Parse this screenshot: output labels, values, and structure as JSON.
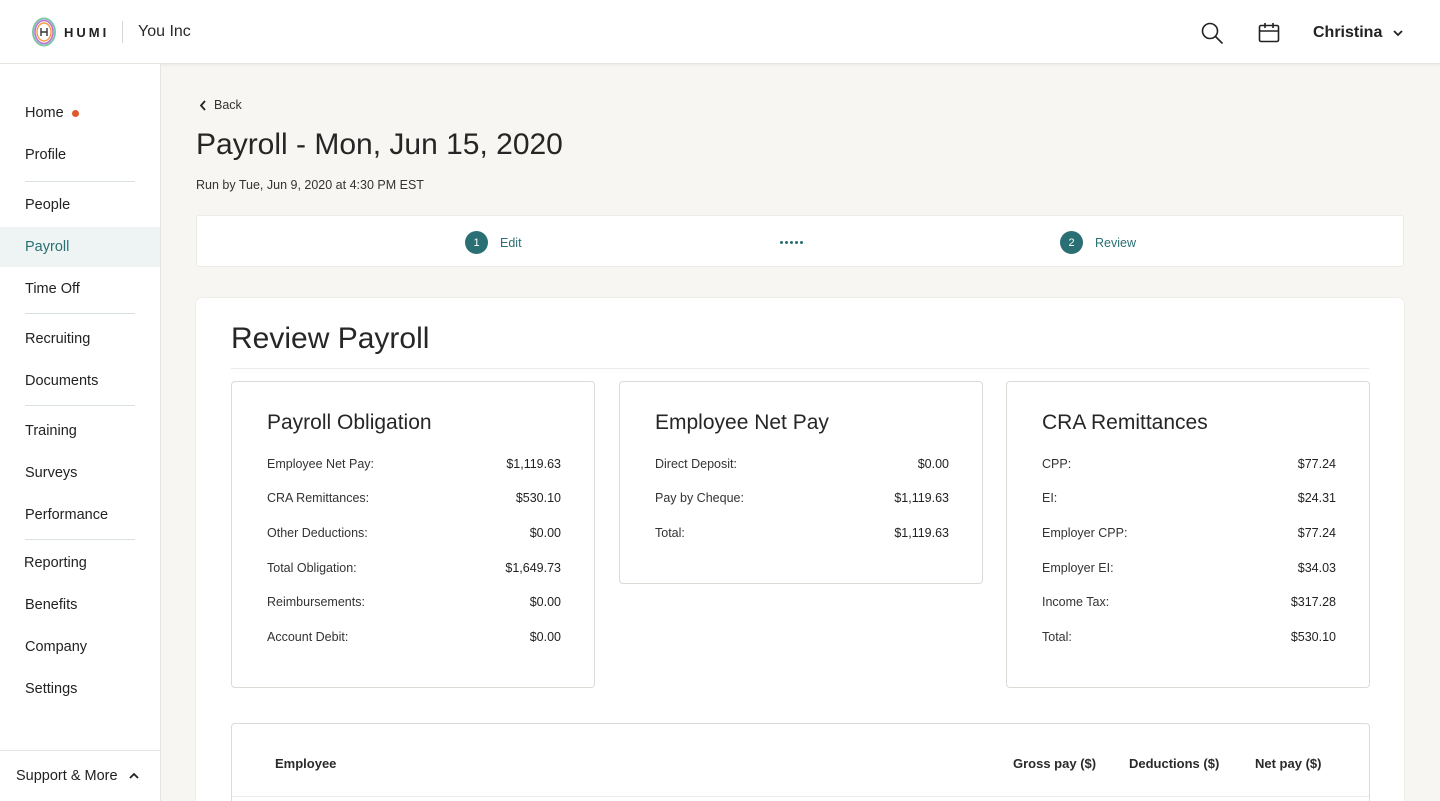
{
  "header": {
    "brand": "HUMI",
    "company": "You Inc",
    "user_name": "Christina"
  },
  "sidebar": {
    "items": [
      {
        "label": "Home"
      },
      {
        "label": "Profile"
      },
      {
        "label": "People"
      },
      {
        "label": "Payroll"
      },
      {
        "label": "Time Off"
      },
      {
        "label": "Recruiting"
      },
      {
        "label": "Documents"
      },
      {
        "label": "Training"
      },
      {
        "label": "Surveys"
      },
      {
        "label": "Performance"
      },
      {
        "label": "Reporting"
      },
      {
        "label": "Benefits"
      },
      {
        "label": "Company"
      },
      {
        "label": "Settings"
      }
    ],
    "active": "Payroll",
    "support_label": "Support & More"
  },
  "page": {
    "back_label": "Back",
    "title": "Payroll - Mon, Jun 15, 2020",
    "run_by": "Run by Tue, Jun 9, 2020 at 4:30 PM EST"
  },
  "stepper": {
    "steps": [
      {
        "num": "1",
        "label": "Edit"
      },
      {
        "num": "2",
        "label": "Review"
      }
    ]
  },
  "review": {
    "title": "Review Payroll",
    "cards": [
      {
        "title": "Payroll Obligation",
        "rows": [
          {
            "label": "Employee Net Pay:",
            "value": "$1,119.63"
          },
          {
            "label": "CRA Remittances:",
            "value": "$530.10"
          },
          {
            "label": "Other Deductions:",
            "value": "$0.00"
          },
          {
            "label": "Total Obligation:",
            "value": "$1,649.73"
          },
          {
            "label": "Reimbursements:",
            "value": "$0.00"
          },
          {
            "label": "Account Debit:",
            "value": "$0.00"
          }
        ]
      },
      {
        "title": "Employee Net Pay",
        "rows": [
          {
            "label": "Direct Deposit:",
            "value": "$0.00"
          },
          {
            "label": "Pay by Cheque:",
            "value": "$1,119.63"
          },
          {
            "label": "Total:",
            "value": "$1,119.63"
          }
        ]
      },
      {
        "title": "CRA Remittances",
        "rows": [
          {
            "label": "CPP:",
            "value": "$77.24"
          },
          {
            "label": "EI:",
            "value": "$24.31"
          },
          {
            "label": "Employer CPP:",
            "value": "$77.24"
          },
          {
            "label": "Employer EI:",
            "value": "$34.03"
          },
          {
            "label": "Income Tax:",
            "value": "$317.28"
          },
          {
            "label": "Total:",
            "value": "$530.10"
          }
        ]
      }
    ],
    "table": {
      "headers": [
        "Employee",
        "Gross pay ($)",
        "Deductions ($)",
        "Net pay ($)"
      ]
    }
  },
  "colors": {
    "accent": "#2a6f73",
    "notification_dot": "#e0592a",
    "background": "#f7f6f3"
  }
}
